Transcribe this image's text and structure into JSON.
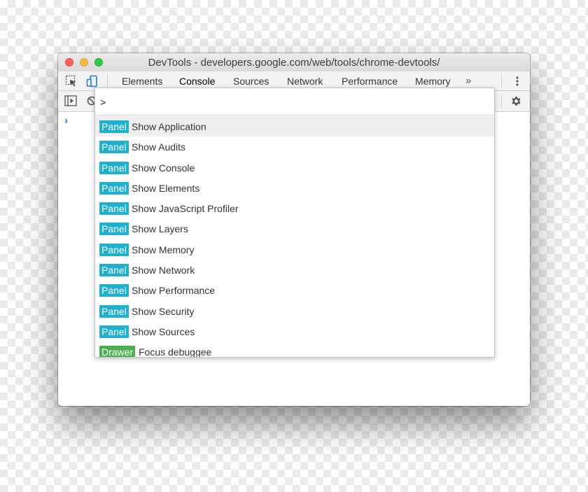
{
  "window": {
    "title": "DevTools - developers.google.com/web/tools/chrome-devtools/"
  },
  "tabs": [
    {
      "label": "Elements",
      "active": false
    },
    {
      "label": "Console",
      "active": true
    },
    {
      "label": "Sources",
      "active": false
    },
    {
      "label": "Network",
      "active": false
    },
    {
      "label": "Performance",
      "active": false
    },
    {
      "label": "Memory",
      "active": false
    }
  ],
  "more_tabs": "»",
  "console": {
    "prompt": "›"
  },
  "command_menu": {
    "input_value": ">",
    "items": [
      {
        "badge": "Panel",
        "label": "Show Application",
        "selected": true
      },
      {
        "badge": "Panel",
        "label": "Show Audits",
        "selected": false
      },
      {
        "badge": "Panel",
        "label": "Show Console",
        "selected": false
      },
      {
        "badge": "Panel",
        "label": "Show Elements",
        "selected": false
      },
      {
        "badge": "Panel",
        "label": "Show JavaScript Profiler",
        "selected": false
      },
      {
        "badge": "Panel",
        "label": "Show Layers",
        "selected": false
      },
      {
        "badge": "Panel",
        "label": "Show Memory",
        "selected": false
      },
      {
        "badge": "Panel",
        "label": "Show Network",
        "selected": false
      },
      {
        "badge": "Panel",
        "label": "Show Performance",
        "selected": false
      },
      {
        "badge": "Panel",
        "label": "Show Security",
        "selected": false
      },
      {
        "badge": "Panel",
        "label": "Show Sources",
        "selected": false
      },
      {
        "badge": "Drawer",
        "label": "Focus debuggee",
        "selected": false
      }
    ]
  },
  "colors": {
    "panel_badge": "#1fb0d0",
    "drawer_badge": "#4caf50",
    "accent": "#1a73e8",
    "device_toggle_active": "#1a73e8"
  }
}
